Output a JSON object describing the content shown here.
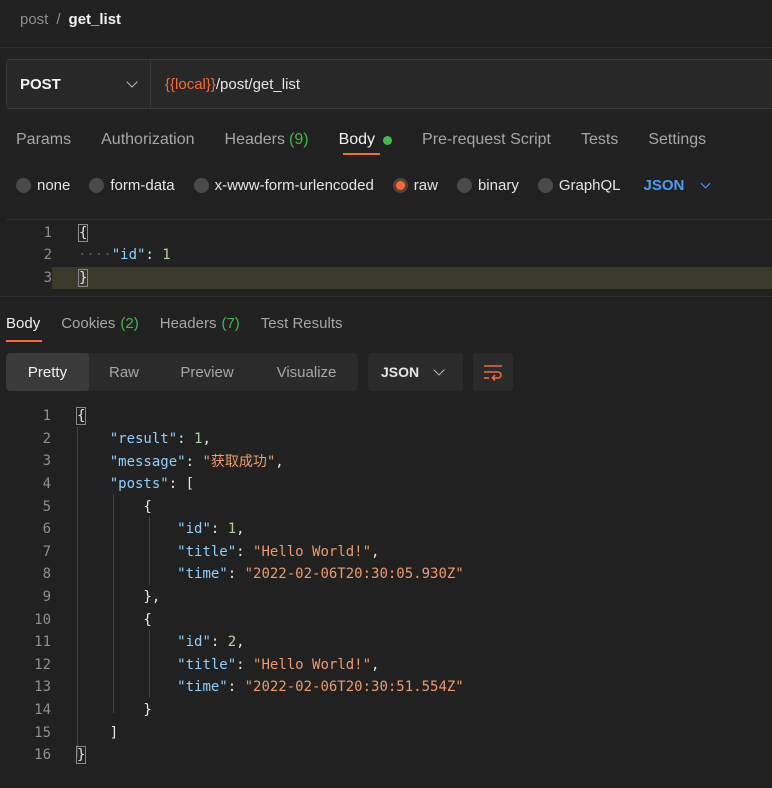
{
  "breadcrumb": {
    "collection": "post",
    "separator": "/",
    "request": "get_list"
  },
  "request": {
    "method": "POST",
    "url_variable": "{{local}}",
    "url_path": "/post/get_list"
  },
  "request_tabs": [
    {
      "label": "Params"
    },
    {
      "label": "Authorization"
    },
    {
      "label": "Headers",
      "count": "(9)"
    },
    {
      "label": "Body",
      "active": true
    },
    {
      "label": "Pre-request Script"
    },
    {
      "label": "Tests"
    },
    {
      "label": "Settings"
    }
  ],
  "body_types": {
    "options": [
      "none",
      "form-data",
      "x-www-form-urlencoded",
      "raw",
      "binary",
      "GraphQL"
    ],
    "selected": "raw",
    "format": "JSON"
  },
  "request_body": {
    "line_numbers": [
      "1",
      "2",
      "3"
    ],
    "lines": [
      "{",
      "\"id\"",
      ": ",
      "1",
      "}"
    ]
  },
  "response_tabs": [
    {
      "label": "Body",
      "active": true
    },
    {
      "label": "Cookies",
      "count": "(2)"
    },
    {
      "label": "Headers",
      "count": "(7)"
    },
    {
      "label": "Test Results"
    }
  ],
  "response_view": {
    "modes": [
      "Pretty",
      "Raw",
      "Preview",
      "Visualize"
    ],
    "active_mode": "Pretty",
    "format": "JSON"
  },
  "response_body": {
    "line_numbers": [
      "1",
      "2",
      "3",
      "4",
      "5",
      "6",
      "7",
      "8",
      "9",
      "10",
      "11",
      "12",
      "13",
      "14",
      "15",
      "16"
    ],
    "result_key": "\"result\"",
    "result_value": "1",
    "message_key": "\"message\"",
    "message_value": "\"获取成功\"",
    "posts_key": "\"posts\"",
    "items": [
      {
        "id_key": "\"id\"",
        "id": "1",
        "title_key": "\"title\"",
        "title": "\"Hello World!\"",
        "time_key": "\"time\"",
        "time": "\"2022-02-06T20:30:05.930Z\""
      },
      {
        "id_key": "\"id\"",
        "id": "2",
        "title_key": "\"title\"",
        "title": "\"Hello World!\"",
        "time_key": "\"time\"",
        "time": "\"2022-02-06T20:30:51.554Z\""
      }
    ]
  },
  "colors": {
    "accent": "#f26b3a",
    "count_green": "#3fb950",
    "json_blue": "#4d9cf2"
  },
  "icons": {
    "method_dropdown": "chevron-down-icon",
    "wrap": "wrap-lines-icon"
  }
}
